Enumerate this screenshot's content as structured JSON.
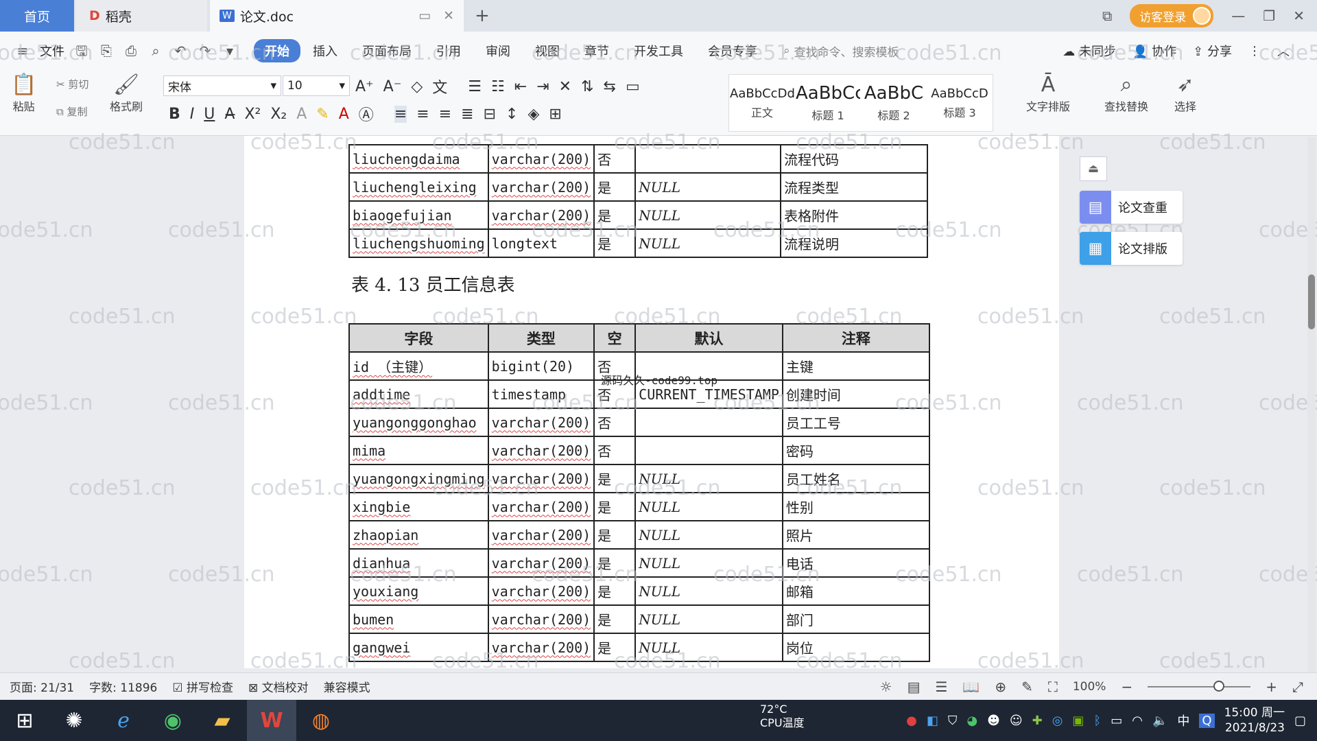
{
  "tabs": {
    "home": "首页",
    "daoke": "稻壳",
    "document": "论文.doc"
  },
  "window": {
    "visitor_login": "访客登录"
  },
  "menu": {
    "file": "文件",
    "tabs": [
      "开始",
      "插入",
      "页面布局",
      "引用",
      "审阅",
      "视图",
      "章节",
      "开发工具",
      "会员专享"
    ],
    "search_placeholder": "查找命令、搜索模板",
    "sync": "未同步",
    "collab": "协作",
    "share": "分享"
  },
  "ribbon": {
    "paste": "粘贴",
    "cut": "剪切",
    "copy": "复制",
    "format_painter": "格式刷",
    "font_name": "宋体",
    "font_size": "10",
    "styles": [
      {
        "sample": "AaBbCcDd",
        "label": "正文"
      },
      {
        "sample": "AaBbCc",
        "label": "标题 1"
      },
      {
        "sample": "AaBbC",
        "label": "标题 2"
      },
      {
        "sample": "AaBbCcD",
        "label": "标题 3"
      }
    ],
    "text_layout": "文字排版",
    "find_replace": "查找替换",
    "select": "选择"
  },
  "side_panel": {
    "check": "论文查重",
    "layout": "论文排版"
  },
  "document": {
    "top_table_rows": [
      [
        "liuchengdaima",
        "varchar(200)",
        "否",
        "",
        "流程代码"
      ],
      [
        "liuchengleixing",
        "varchar(200)",
        "是",
        "NULL",
        "流程类型"
      ],
      [
        "biaogefujian",
        "varchar(200)",
        "是",
        "NULL",
        "表格附件"
      ],
      [
        "liuchengshuoming",
        "longtext",
        "是",
        "NULL",
        "流程说明"
      ]
    ],
    "caption": "表 4. 13 员工信息表",
    "headers": [
      "字段",
      "类型",
      "空",
      "默认",
      "注释"
    ],
    "rows": [
      [
        "id  （主键）",
        "bigint(20)",
        "否",
        "",
        "主键"
      ],
      [
        "addtime",
        "timestamp",
        "否",
        "CURRENT_TIMESTAMP",
        "创建时间"
      ],
      [
        "yuangonggonghao",
        "varchar(200)",
        "否",
        "",
        "员工工号"
      ],
      [
        "mima",
        "varchar(200)",
        "否",
        "",
        "密码"
      ],
      [
        "yuangongxingming",
        "varchar(200)",
        "是",
        "NULL",
        "员工姓名"
      ],
      [
        "xingbie",
        "varchar(200)",
        "是",
        "NULL",
        "性别"
      ],
      [
        "zhaopian",
        "varchar(200)",
        "是",
        "NULL",
        "照片"
      ],
      [
        "dianhua",
        "varchar(200)",
        "是",
        "NULL",
        "电话"
      ],
      [
        "youxiang",
        "varchar(200)",
        "是",
        "NULL",
        "邮箱"
      ],
      [
        "bumen",
        "varchar(200)",
        "是",
        "NULL",
        "部门"
      ],
      [
        "gangwei",
        "varchar(200)",
        "是",
        "NULL",
        "岗位"
      ]
    ],
    "overlay_text": "源码久久-code99.top",
    "watermark": "code51.cn"
  },
  "status": {
    "page": "页面: 21/31",
    "words": "字数: 11896",
    "spell_check": "拼写检查",
    "doc_check": "文档校对",
    "compat_mode": "兼容模式",
    "zoom": "100%"
  },
  "taskbar": {
    "cpu_temp": "72°C",
    "cpu_label": "CPU温度",
    "ime": "中",
    "time": "15:00 周一",
    "date": "2021/8/23"
  }
}
